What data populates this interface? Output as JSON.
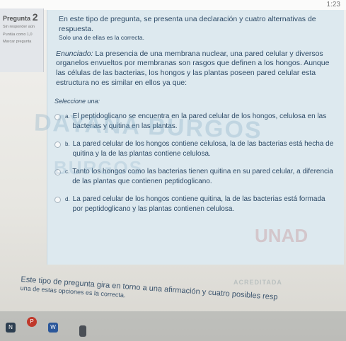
{
  "status": {
    "time": "1:23"
  },
  "sidebar": {
    "question_label": "Pregunta",
    "question_number": "2",
    "meta": [
      "Sin responder aún",
      "Puntúa como 1,0",
      "Marcar pregunta"
    ]
  },
  "question": {
    "intro_line1": "En este tipo de pregunta, se presenta una declaración y cuatro alternativas de respuesta.",
    "intro_line2": "Solo una de ellas es la correcta.",
    "enunciado_label": "Enunciado:",
    "enunciado_text": "La presencia de una membrana nuclear, una pared celular y diversos organelos envueltos por membranas son rasgos que definen a los hongos. Aunque las células de las bacterias, los hongos y las plantas poseen pared celular esta estructura no es similar en ellos ya que:",
    "seleccione": "Seleccione una:",
    "options": [
      {
        "letter": "a.",
        "text": "El peptidoglicano se encuentra en la pared celular de los hongos, celulosa en las bacterias y quitina en las plantas."
      },
      {
        "letter": "b.",
        "text": "La pared celular de los hongos contiene celulosa, la de las bacterias está hecha de quitina y la de las plantas contiene celulosa."
      },
      {
        "letter": "c.",
        "text": "Tanto los hongos como las bacterias tienen quitina en su pared celular, a diferencia de las plantas que contienen peptidoglicano."
      },
      {
        "letter": "d.",
        "text": "La pared celular de los hongos contiene quitina, la de las bacterias está formada por peptidoglicano y las plantas contienen celulosa."
      }
    ]
  },
  "watermark": {
    "name_line1": "DAYANA BURGOS",
    "name_line2": "BURGOS",
    "logo": "UNAD",
    "acreditada": "ACREDITADA"
  },
  "next_question": {
    "line1": "Este tipo de pregunta gira en torno a una afirmación y cuatro posibles resp",
    "line2": "una de estas opciones es la correcta."
  },
  "taskbar": {
    "icons": [
      "P",
      "W",
      "N"
    ]
  },
  "colors": {
    "content_bg": "#dde9ef",
    "text": "#2d4a66"
  }
}
